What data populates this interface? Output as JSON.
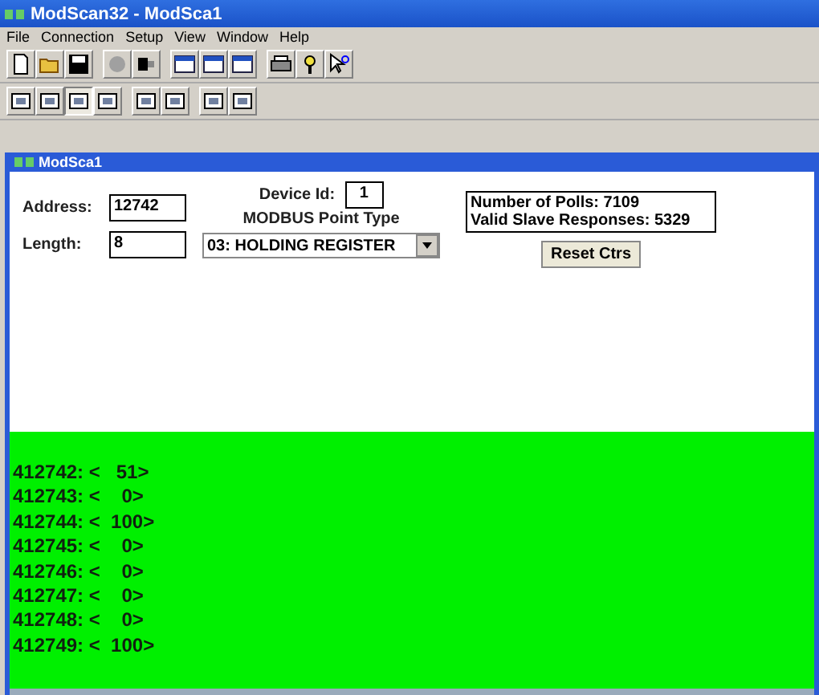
{
  "window": {
    "title": "ModScan32 - ModSca1"
  },
  "menu": [
    "File",
    "Connection",
    "Setup",
    "View",
    "Window",
    "Help"
  ],
  "toolbar": [
    [
      {
        "kind": "new"
      },
      {
        "kind": "open"
      },
      {
        "kind": "save"
      }
    ],
    [
      {
        "kind": "connect"
      },
      {
        "kind": "disconnect"
      }
    ],
    [
      {
        "kind": "window"
      },
      {
        "kind": "window"
      },
      {
        "kind": "window"
      }
    ],
    [
      {
        "kind": "print"
      },
      {
        "kind": "about"
      },
      {
        "kind": "help"
      }
    ]
  ],
  "format_toolbar": [
    [
      {
        "selected": false
      },
      {
        "selected": false
      },
      {
        "selected": true
      },
      {
        "selected": false
      }
    ],
    [
      {
        "selected": false
      },
      {
        "selected": false
      }
    ],
    [
      {
        "selected": false
      },
      {
        "selected": false
      }
    ]
  ],
  "child_window": {
    "title": "ModSca1"
  },
  "form": {
    "address_label": "Address:",
    "address": "12742",
    "length_label": "Length:",
    "length": "8",
    "device_id_label": "Device Id:",
    "device_id": "1",
    "point_type_label": "MODBUS Point Type",
    "point_type": "03: HOLDING REGISTER",
    "polls": "Number of Polls: 7109",
    "responses": "Valid Slave Responses: 5329",
    "reset_button": "Reset Ctrs"
  },
  "registers": [
    {
      "address": "412742:",
      "value": "<   51>"
    },
    {
      "address": "412743:",
      "value": "<    0>"
    },
    {
      "address": "412744:",
      "value": "<  100>"
    },
    {
      "address": "412745:",
      "value": "<    0>"
    },
    {
      "address": "412746:",
      "value": "<    0>"
    },
    {
      "address": "412747:",
      "value": "<    0>"
    },
    {
      "address": "412748:",
      "value": "<    0>"
    },
    {
      "address": "412749:",
      "value": "<  100>"
    }
  ]
}
